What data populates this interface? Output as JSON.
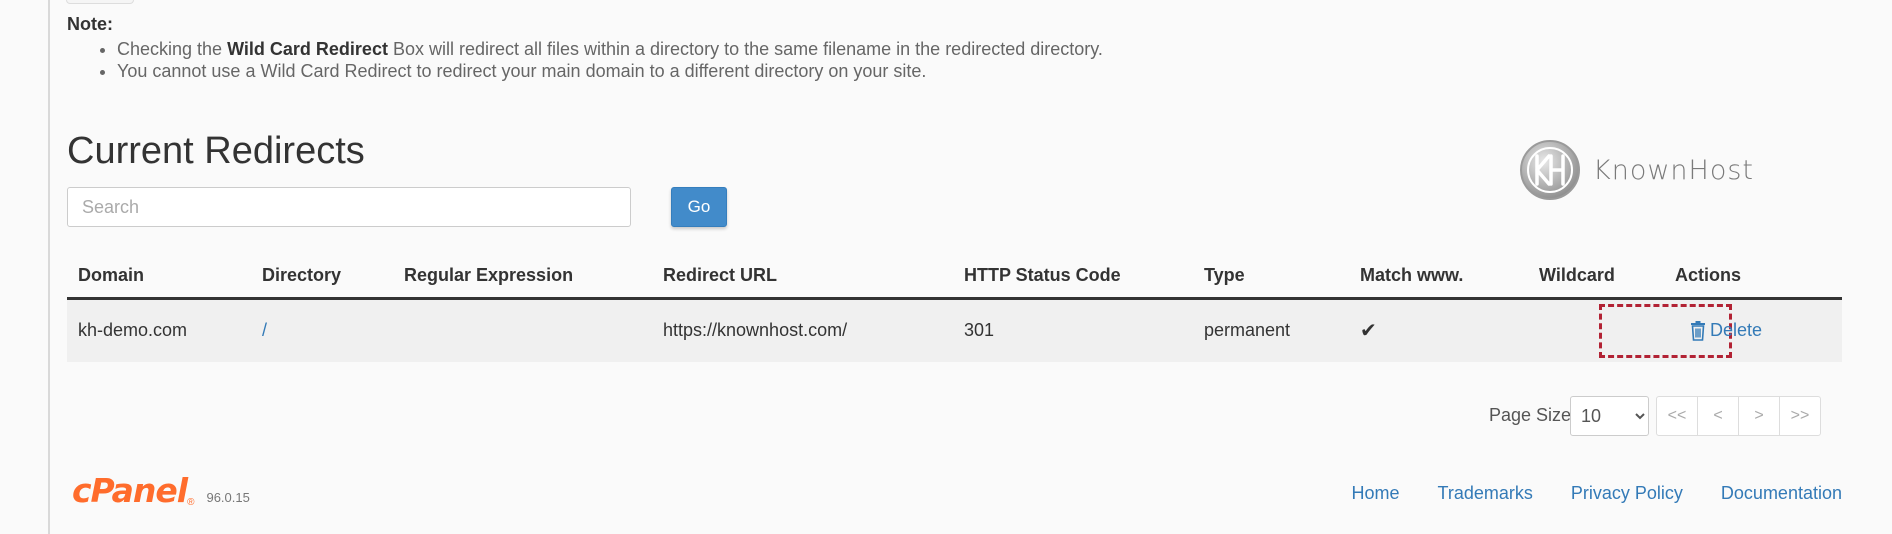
{
  "note": {
    "title": "Note:",
    "items": [
      {
        "pre": "Checking the ",
        "bold": "Wild Card Redirect",
        "post": " Box will redirect all files within a directory to the same filename in the redirected directory."
      },
      {
        "pre": "You cannot use a Wild Card Redirect to redirect your main domain to a different directory on your site.",
        "bold": "",
        "post": ""
      }
    ]
  },
  "section_title": "Current Redirects",
  "search": {
    "placeholder": "Search",
    "value": "",
    "go_label": "Go"
  },
  "logo": {
    "text": "KnownHost",
    "icon": "knownhost-kh-logo-icon"
  },
  "table": {
    "headers": [
      "Domain",
      "Directory",
      "Regular Expression",
      "Redirect URL",
      "HTTP Status Code",
      "Type",
      "Match www.",
      "Wildcard",
      "Actions"
    ],
    "rows": [
      {
        "domain": "kh-demo.com",
        "directory": "/",
        "regex": "",
        "redirect_url": "https://knownhost.com/",
        "status_code": "301",
        "type": "permanent",
        "match_www": "✔",
        "wildcard": "",
        "action_label": "Delete"
      }
    ]
  },
  "pagination": {
    "page_size_label": "Page Size",
    "page_size_value": "10",
    "page_size_options": [
      "10"
    ],
    "buttons": [
      "<<",
      "<",
      ">",
      ">>"
    ]
  },
  "footer": {
    "brand": "cPanel",
    "trademark": "®",
    "version": "96.0.15",
    "links": [
      "Home",
      "Trademarks",
      "Privacy Policy",
      "Documentation"
    ]
  },
  "colors": {
    "accent": "#428bca",
    "link": "#337ab7",
    "cpanel_orange": "#ff6c2c",
    "highlight_box": "#b22234"
  }
}
